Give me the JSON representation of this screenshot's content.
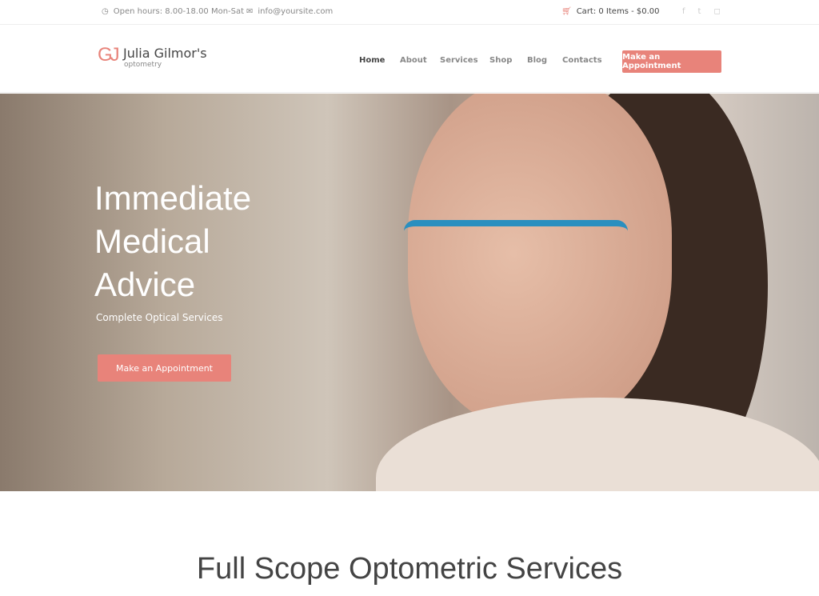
{
  "topbar": {
    "hours": "Open hours: 8.00-18.00 Mon-Sat",
    "email": "info@yoursite.com",
    "cart": "Cart: 0 Items - $0.00"
  },
  "logo": {
    "mark": "GJ",
    "title": "Julia Gilmor's",
    "subtitle": "optometry"
  },
  "nav": {
    "items": [
      "Home",
      "About",
      "Services",
      "Shop",
      "Blog",
      "Contacts"
    ],
    "cta": "Make an Appointment"
  },
  "hero": {
    "line1": "Immediate",
    "line2": "Medical",
    "line3": "Advice",
    "subtitle": "Complete Optical Services",
    "cta": "Make an Appointment"
  },
  "section": {
    "title": "Full Scope Optometric Services"
  },
  "colors": {
    "accent": "#e8837a"
  }
}
